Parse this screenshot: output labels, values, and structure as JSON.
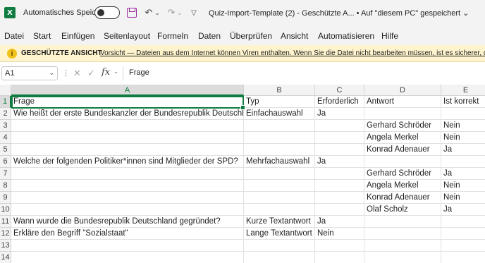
{
  "titlebar": {
    "app_logo": "X",
    "autosave_label": "Automatisches Speichern",
    "autosave_state": "off",
    "doc_title": "Quiz-Import-Template (2)  -  Geschützte A...  •  Auf \"diesem PC\" gespeichert ⌄"
  },
  "ribbon": {
    "tabs": [
      "Datei",
      "Start",
      "Einfügen",
      "Seitenlayout",
      "Formeln",
      "Daten",
      "Überprüfen",
      "Ansicht",
      "Automatisieren",
      "Hilfe"
    ]
  },
  "protected_view": {
    "title": "GESCHÜTZTE ANSICHT",
    "message": "Vorsicht — Dateien aus dem Internet können Viren enthalten. Wenn Sie die Datei nicht bearbeiten müssen, ist es sicherer, die g"
  },
  "formula_bar": {
    "name_box": "A1",
    "fx": "fx",
    "content": "Frage"
  },
  "sheet": {
    "columns": [
      "A",
      "B",
      "C",
      "D",
      "E"
    ],
    "selected_column": "A",
    "selected_row": "1",
    "rows": [
      {
        "n": "1",
        "cells": [
          "Frage",
          "Typ",
          "Erforderlich",
          "Antwort",
          "Ist korrekt"
        ]
      },
      {
        "n": "2",
        "cells": [
          "Wie heißt der erste Bundeskanzler der Bundesrepublik Deutschland?",
          "Einfachauswahl",
          "Ja",
          "",
          ""
        ]
      },
      {
        "n": "3",
        "cells": [
          "",
          "",
          "",
          "Gerhard Schröder",
          "Nein"
        ]
      },
      {
        "n": "4",
        "cells": [
          "",
          "",
          "",
          "Angela Merkel",
          "Nein"
        ]
      },
      {
        "n": "5",
        "cells": [
          "",
          "",
          "",
          "Konrad Adenauer",
          "Ja"
        ]
      },
      {
        "n": "6",
        "cells": [
          "Welche der folgenden Politiker*innen sind Mitglieder der SPD?",
          "Mehrfachauswahl",
          "Ja",
          "",
          ""
        ]
      },
      {
        "n": "7",
        "cells": [
          "",
          "",
          "",
          "Gerhard Schröder",
          "Ja"
        ]
      },
      {
        "n": "8",
        "cells": [
          "",
          "",
          "",
          "Angela Merkel",
          "Nein"
        ]
      },
      {
        "n": "9",
        "cells": [
          "",
          "",
          "",
          "Konrad Adenauer",
          "Nein"
        ]
      },
      {
        "n": "10",
        "cells": [
          "",
          "",
          "",
          "Olaf Scholz",
          "Ja"
        ]
      },
      {
        "n": "11",
        "cells": [
          "Wann wurde die Bundesrepublik Deutschland gegründet?",
          "Kurze Textantwort",
          "Ja",
          "",
          ""
        ]
      },
      {
        "n": "12",
        "cells": [
          "Erkläre den Begriff \"Sozialstaat\"",
          "Lange Textantwort",
          "Nein",
          "",
          ""
        ]
      },
      {
        "n": "13",
        "cells": [
          "",
          "",
          "",
          "",
          ""
        ]
      },
      {
        "n": "14",
        "cells": [
          "",
          "",
          "",
          "",
          ""
        ]
      }
    ]
  },
  "colors": {
    "excel_green": "#107c41",
    "protected_bar": "#fff4ce",
    "save_icon": "#9b2a9b"
  }
}
